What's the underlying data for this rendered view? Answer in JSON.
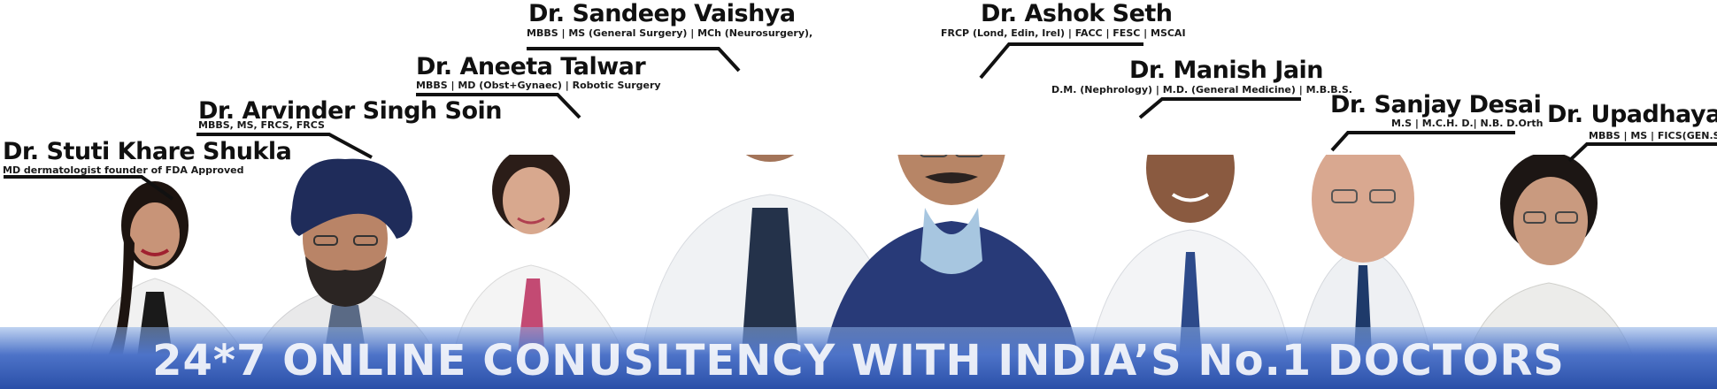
{
  "banner": {
    "headline": "24*7 ONLINE CONUSLTENCY WITH INDIA’S  No.1  DOCTORS"
  },
  "doctors": [
    {
      "name": "Dr. Stuti Khare Shukla",
      "credentials": "MD dermatologist founder of FDA Approved"
    },
    {
      "name": "Dr. Arvinder Singh Soin",
      "credentials": "MBBS, MS, FRCS, FRCS"
    },
    {
      "name": "Dr. Aneeta Talwar",
      "credentials": "MBBS | MD (Obst+Gynaec) | Robotic Surgery"
    },
    {
      "name": "Dr. Sandeep Vaishya",
      "credentials": "MBBS | MS (General Surgery) | MCh (Neurosurgery),"
    },
    {
      "name": "Dr. Ashok Seth",
      "credentials": "FRCP (Lond, Edin, Irel) | FACC | FESC | MSCAI"
    },
    {
      "name": "Dr. Manish Jain",
      "credentials": "D.M. (Nephrology) | M.D. (General Medicine) | M.B.B.S."
    },
    {
      "name": "Dr. Sanjay Desai",
      "credentials": "M.S | M.C.H. D.| N.B. D.Orth"
    },
    {
      "name": "Dr. Upadhayay",
      "credentials": "MBBS | MS | FICS(GEN.Surg.)"
    }
  ]
}
